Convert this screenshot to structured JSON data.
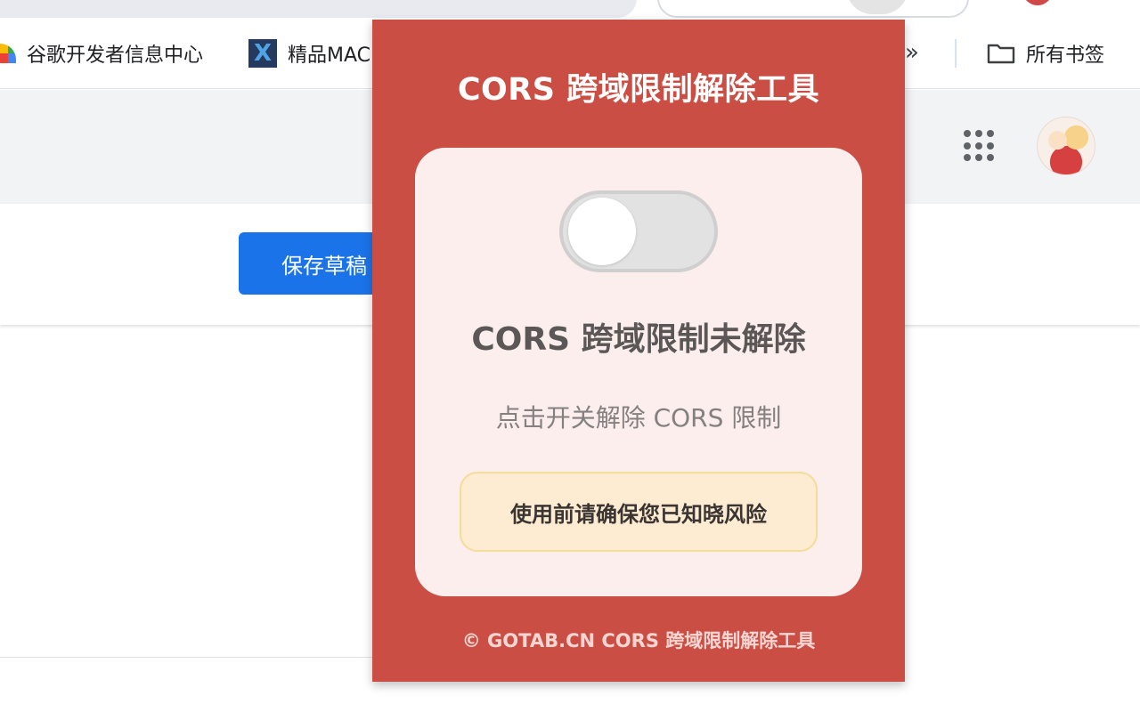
{
  "bookmarks_bar": {
    "items": [
      {
        "label": "谷歌开发者信息中心",
        "icon": "rainbow-icon"
      },
      {
        "label": "精品MAC",
        "icon": "x-logo-icon"
      }
    ],
    "overflow": "»",
    "all_bookmarks": {
      "label": "所有书签",
      "icon": "folder-icon"
    }
  },
  "page": {
    "save_button": "保存草稿"
  },
  "popup": {
    "title": "CORS 跨域限制解除工具",
    "toggle_state": "off",
    "status": "CORS 跨域限制未解除",
    "hint": "点击开关解除 CORS 限制",
    "warning": "使用前请确保您已知晓风险",
    "footer": "© GOTAB.CN CORS 跨域限制解除工具",
    "colors": {
      "background": "#cb4e44",
      "card": "#fbeeec",
      "warning_bg": "#fdecd1",
      "warning_border": "#f6dc9a"
    }
  }
}
